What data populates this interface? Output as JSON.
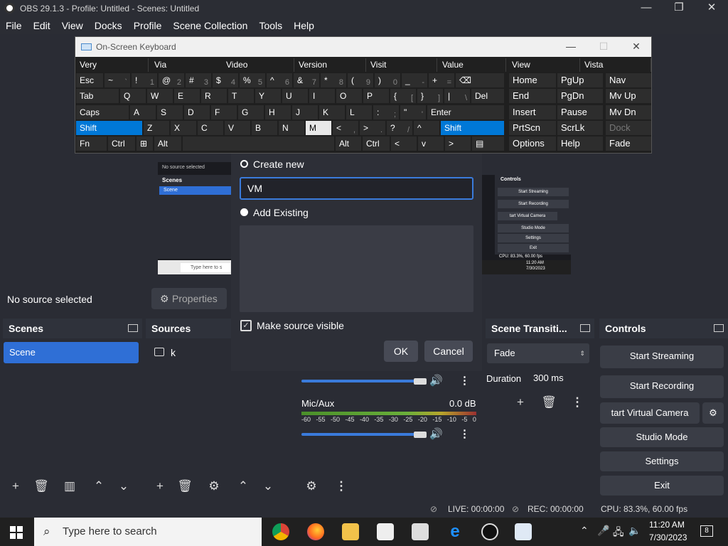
{
  "window": {
    "title": "OBS 29.1.3 - Profile: Untitled - Scenes: Untitled",
    "min": "—",
    "max": "❐",
    "close": "✕"
  },
  "menu": [
    "File",
    "Edit",
    "View",
    "Docks",
    "Profile",
    "Scene Collection",
    "Tools",
    "Help"
  ],
  "osk": {
    "title": "On-Screen Keyboard",
    "predictions": [
      "Very",
      "Via",
      "Video",
      "Version",
      "Visit",
      "Value",
      "View",
      "Vista"
    ],
    "rows": [
      [
        {
          "l": "Esc"
        },
        {
          "l": "~",
          "s": "`"
        },
        {
          "l": "!",
          "s": "1"
        },
        {
          "l": "@",
          "s": "2"
        },
        {
          "l": "#",
          "s": "3"
        },
        {
          "l": "$",
          "s": "4"
        },
        {
          "l": "%",
          "s": "5"
        },
        {
          "l": "^",
          "s": "6"
        },
        {
          "l": "&",
          "s": "7"
        },
        {
          "l": "*",
          "s": "8"
        },
        {
          "l": "(",
          "s": "9"
        },
        {
          "l": ")",
          "s": "0"
        },
        {
          "l": "_",
          "s": "-"
        },
        {
          "l": "+",
          "s": "="
        },
        {
          "l": "⌫"
        }
      ],
      [
        {
          "l": "Tab"
        },
        {
          "l": "Q"
        },
        {
          "l": "W"
        },
        {
          "l": "E"
        },
        {
          "l": "R"
        },
        {
          "l": "T"
        },
        {
          "l": "Y"
        },
        {
          "l": "U"
        },
        {
          "l": "I"
        },
        {
          "l": "O"
        },
        {
          "l": "P"
        },
        {
          "l": "{",
          "s": "["
        },
        {
          "l": "}",
          "s": "]"
        },
        {
          "l": "|",
          "s": "\\"
        },
        {
          "l": "Del"
        }
      ],
      [
        {
          "l": "Caps"
        },
        {
          "l": "A"
        },
        {
          "l": "S"
        },
        {
          "l": "D"
        },
        {
          "l": "F"
        },
        {
          "l": "G"
        },
        {
          "l": "H"
        },
        {
          "l": "J"
        },
        {
          "l": "K"
        },
        {
          "l": "L"
        },
        {
          "l": ":",
          "s": ";"
        },
        {
          "l": "\"",
          "s": "'"
        },
        {
          "l": "Enter"
        }
      ],
      [
        {
          "l": "Shift"
        },
        {
          "l": "Z"
        },
        {
          "l": "X"
        },
        {
          "l": "C"
        },
        {
          "l": "V"
        },
        {
          "l": "B"
        },
        {
          "l": "N"
        },
        {
          "l": "M"
        },
        {
          "l": "<",
          "s": ","
        },
        {
          "l": ">",
          "s": "."
        },
        {
          "l": "?",
          "s": "/"
        },
        {
          "l": "^"
        },
        {
          "l": "Shift"
        }
      ],
      [
        {
          "l": "Fn"
        },
        {
          "l": "Ctrl"
        },
        {
          "l": "⊞"
        },
        {
          "l": "Alt"
        },
        {
          "l": ""
        },
        {
          "l": "Alt"
        },
        {
          "l": "Ctrl"
        },
        {
          "l": "<"
        },
        {
          "l": "v"
        },
        {
          "l": ">"
        },
        {
          "l": "▤"
        }
      ]
    ],
    "nav": [
      [
        "Home",
        "PgUp",
        "Nav"
      ],
      [
        "End",
        "PgDn",
        "Mv Up"
      ],
      [
        "Insert",
        "Pause",
        "Mv Dn"
      ],
      [
        "PrtScn",
        "ScrLk",
        "Dock"
      ],
      [
        "Options",
        "Help",
        "Fade"
      ]
    ]
  },
  "mini": {
    "no_source": "No source selected",
    "scenes": "Scenes",
    "scene": "Scene",
    "controls": "Controls",
    "c1": "Start Streaming",
    "c2": "Start Recording",
    "c3": "tart Virtual Camera",
    "c4": "Studio Mode",
    "c5": "Settings",
    "c6": "Exit",
    "cpu": "CPU: 83.3%, 60.00 fps",
    "search": "Type here to s",
    "time": "11:20 AM",
    "date": "7/30/2023"
  },
  "context": {
    "no_source": "No source selected",
    "properties": "Properties"
  },
  "docks": {
    "scenes": {
      "title": "Scenes",
      "items": [
        "Scene"
      ]
    },
    "sources": {
      "title": "Sources",
      "items": [
        "k"
      ]
    },
    "transitions": {
      "title": "Scene Transiti...",
      "type": "Fade",
      "duration_label": "Duration",
      "duration": "300 ms"
    },
    "controls": {
      "title": "Controls",
      "buttons": [
        "Start Streaming",
        "Start Recording",
        "tart Virtual Camera",
        "Studio Mode",
        "Settings",
        "Exit"
      ]
    }
  },
  "mixer": {
    "track": "Mic/Aux",
    "db": "0.0 dB",
    "scale": [
      "-60",
      "-55",
      "-50",
      "-45",
      "-40",
      "-35",
      "-30",
      "-25",
      "-20",
      "-15",
      "-10",
      "-5",
      "0"
    ]
  },
  "dialog": {
    "create_new": "Create new",
    "name_value": "VM",
    "add_existing": "Add Existing",
    "make_visible": "Make source visible",
    "ok": "OK",
    "cancel": "Cancel"
  },
  "status": {
    "live": "LIVE: 00:00:00",
    "rec": "REC: 00:00:00",
    "cpu": "CPU: 83.3%, 60.00 fps"
  },
  "taskbar": {
    "search": "Type here to search",
    "time": "11:20 AM",
    "date": "7/30/2023",
    "notif": "8"
  }
}
